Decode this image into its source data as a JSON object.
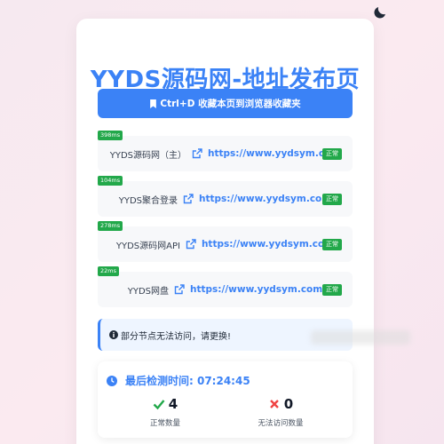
{
  "header": {
    "theme_toggle_icon": "moon-icon"
  },
  "page": {
    "title": "YYDS源码网-地址发布页"
  },
  "bookmark": {
    "label": "Ctrl+D 收藏本页到浏览器收藏夹",
    "icon": "bookmark-icon"
  },
  "nodes": [
    {
      "latency": "398ms",
      "name": "YYDS源码网（主）",
      "url": "https://www.yydsym.com",
      "status": "正常"
    },
    {
      "latency": "104ms",
      "name": "YYDS聚合登录",
      "url": "https://www.yydsym.com",
      "status": "正常"
    },
    {
      "latency": "278ms",
      "name": "YYDS源码网API",
      "url": "https://www.yydsym.com",
      "status": "正常"
    },
    {
      "latency": "22ms",
      "name": "YYDS网盘",
      "url": "https://www.yydsym.com",
      "status": "正常"
    }
  ],
  "notice": {
    "text": "部分节点无法访问，请更换!",
    "icon": "info-icon"
  },
  "stats": {
    "last_check_label": "最后检测时间: 07:24:45",
    "ok_count": "4",
    "ok_label": "正常数量",
    "fail_count": "0",
    "fail_label": "无法访问数量"
  },
  "colors": {
    "accent": "#3b82f6",
    "success": "#22a84a",
    "danger": "#ef4444"
  }
}
